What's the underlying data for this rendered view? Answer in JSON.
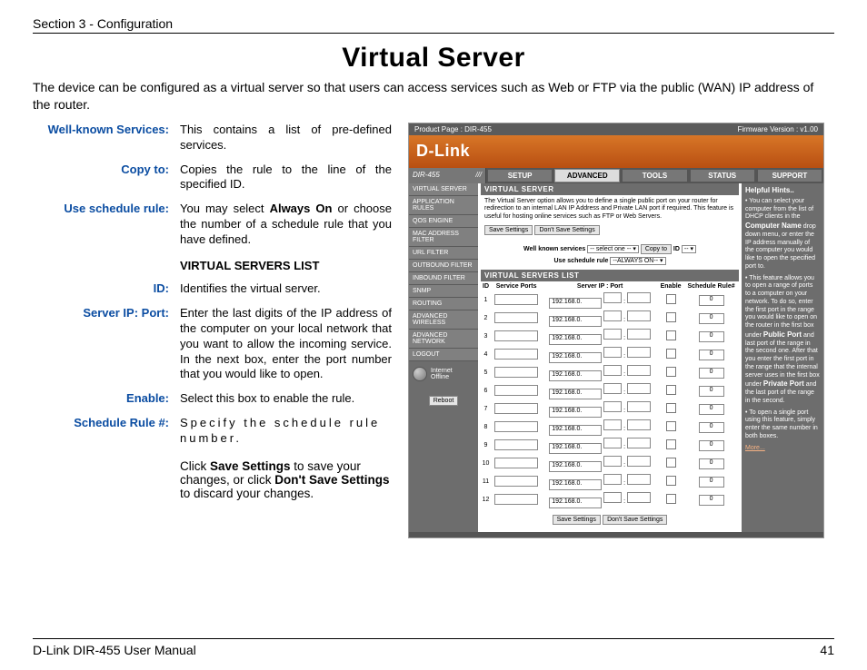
{
  "header": {
    "section": "Section 3 - Configuration",
    "title": "Virtual Server"
  },
  "intro": "The device can be configured as a virtual server so that users can access services such as Web or FTP via the public (WAN) IP address of the router.",
  "definitions": [
    {
      "term": "Well-known Services:",
      "desc": "This contains a list of pre-defined services."
    },
    {
      "term": "Copy to:",
      "desc": "Copies the rule to the line of the specified ID."
    },
    {
      "term": "Use schedule rule:",
      "desc_html": "You may select <b>Always On</b> or choose the number of a schedule rule that you have defined."
    },
    {
      "heading": "VIRTUAL SERVERS LIST"
    },
    {
      "term": "ID:",
      "desc": "Identifies the virtual server."
    },
    {
      "term": "Server IP: Port:",
      "desc": "Enter the last digits of the IP address of the computer on your local network that you want to allow the incoming service. In the next box, enter the port number that you would like to open."
    },
    {
      "term": "Enable:",
      "desc": "Select this box to enable the rule."
    },
    {
      "term": "Schedule Rule #:",
      "desc_html": "Specify the schedule rule number.",
      "spread": true
    }
  ],
  "footer_note_html": "Click <b>Save Settings</b> to save your changes, or click <b>Don't Save Settings</b> to discard your changes.",
  "page_footer": {
    "left": "D-Link DIR-455 User Manual",
    "right": "41"
  },
  "router": {
    "topbar_left": "Product Page : DIR-455",
    "topbar_right": "Firmware Version : v1.00",
    "logo": "D-Link",
    "model": "DIR-455",
    "tabs": [
      "SETUP",
      "ADVANCED",
      "TOOLS",
      "STATUS",
      "SUPPORT"
    ],
    "active_tab": "ADVANCED",
    "leftnav": [
      "VIRTUAL SERVER",
      "APPLICATION RULES",
      "QOS ENGINE",
      "MAC ADDRESS FILTER",
      "URL FILTER",
      "OUTBOUND FILTER",
      "INBOUND FILTER",
      "SNMP",
      "ROUTING",
      "ADVANCED WIRELESS",
      "ADVANCED NETWORK",
      "LOGOUT"
    ],
    "status_label": "Internet\nOffline",
    "reboot": "Reboot",
    "panel1": {
      "title": "VIRTUAL SERVER",
      "text": "The Virtual Server option allows you to define a single public port on your router for redirection to an internal LAN IP Address and Private LAN port if required. This feature is useful for hosting online services such as FTP or Web Servers.",
      "save": "Save Settings",
      "dont": "Don't Save Settings"
    },
    "controls": {
      "well_label": "Well known services",
      "well_value": "-- select one --",
      "copy": "Copy to",
      "id_label": "ID",
      "id_value": "--",
      "sched_label": "Use schedule rule",
      "sched_value": "--ALWAYS ON--"
    },
    "list_title": "VIRTUAL SERVERS LIST",
    "list_headers": [
      "ID",
      "Service Ports",
      "Server IP : Port",
      "Enable",
      "Schedule Rule#"
    ],
    "rows": [
      {
        "id": 1,
        "ip": "192.168.0.",
        "sched": "0"
      },
      {
        "id": 2,
        "ip": "192.168.0.",
        "sched": "0"
      },
      {
        "id": 3,
        "ip": "192.168.0.",
        "sched": "0"
      },
      {
        "id": 4,
        "ip": "192.168.0.",
        "sched": "0"
      },
      {
        "id": 5,
        "ip": "192.168.0.",
        "sched": "0"
      },
      {
        "id": 6,
        "ip": "192.168.0.",
        "sched": "0"
      },
      {
        "id": 7,
        "ip": "192.168.0.",
        "sched": "0"
      },
      {
        "id": 8,
        "ip": "192.168.0.",
        "sched": "0"
      },
      {
        "id": 9,
        "ip": "192.168.0.",
        "sched": "0"
      },
      {
        "id": 10,
        "ip": "192.168.0.",
        "sched": "0"
      },
      {
        "id": 11,
        "ip": "192.168.0.",
        "sched": "0"
      },
      {
        "id": 12,
        "ip": "192.168.0.",
        "sched": "0"
      }
    ],
    "hints": {
      "title": "Helpful Hints..",
      "b1_html": "• You can select your computer from the list of DHCP clients in the <b>Computer Name</b> drop down menu, or enter the IP address manually of the computer you would like to open the specified port to.",
      "b2_html": "• This feature allows you to open a range of ports to a computer on your network. To do so, enter the first port in the range you would like to open on the router in the first box under <b>Public Port</b> and last port of the range in the second one. After that you enter the first port in the range that the internal server uses in the first box under <b>Private Port</b> and the last port of the range in the second.",
      "b3_html": "• To open a single port using this feature, simply enter the same number in both boxes.",
      "more": "More..."
    }
  }
}
